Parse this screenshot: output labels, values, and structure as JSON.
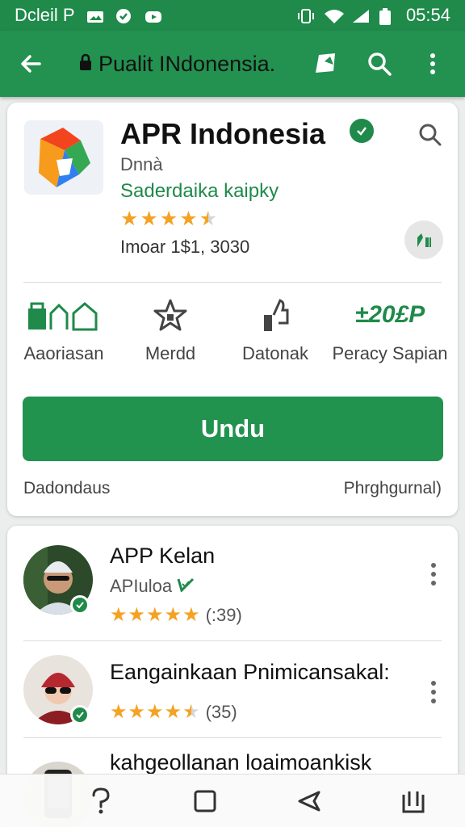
{
  "status_bar": {
    "carrier": "Dcleil P",
    "time": "05:54",
    "icons": [
      "image-icon",
      "message-icon",
      "video-icon",
      "vibrate-icon",
      "wifi-icon",
      "signal-icon",
      "battery-icon"
    ]
  },
  "app_bar": {
    "title": "Pualit INdonensia.",
    "icons": [
      "back-arrow-icon",
      "lock-icon",
      "bookmark-icon",
      "search-icon",
      "more-vert-icon"
    ]
  },
  "app": {
    "name": "APR Indonesia",
    "developer": "Dnnà",
    "category": "Saderdaika kaipky",
    "rating": 4.5,
    "installs": "Imoar 1$1, 3030",
    "features": [
      {
        "icon": "store-icon",
        "label": "Aaoriasan"
      },
      {
        "icon": "star-icon",
        "label": "Merdd"
      },
      {
        "icon": "thumb-icon",
        "label": "Datonak"
      },
      {
        "icon": "price-icon",
        "value": "±20£P",
        "label": "Peracy Sapian"
      }
    ],
    "install_label": "Undu",
    "footer_left": "Dadondaus",
    "footer_right": "Phrghgurnal)"
  },
  "list": [
    {
      "title": "APP Kelan",
      "subtitle": "APIuloa",
      "rating": 5,
      "count": "(:39)"
    },
    {
      "title": "Eangainkaan Pnimicansakal:",
      "subtitle": "",
      "rating": 4.5,
      "count": "(35)"
    },
    {
      "title": "kahgeollanan loaimoankisk",
      "subtitle": "",
      "rating": 0,
      "count": ""
    }
  ],
  "colors": {
    "primary": "#239150",
    "status": "#1f8a4a",
    "star": "#f4a223"
  }
}
